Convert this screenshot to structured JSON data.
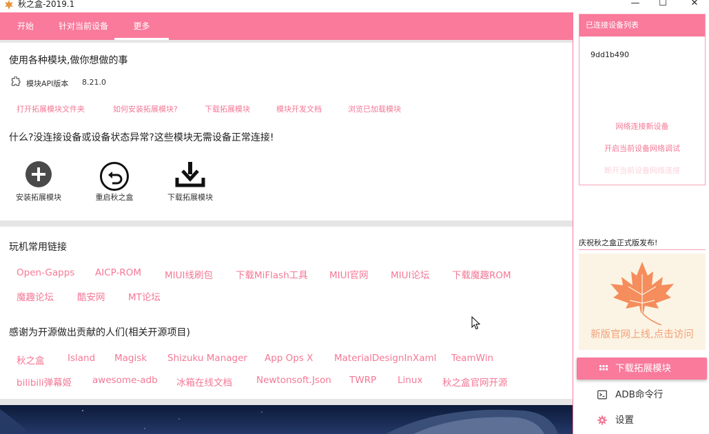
{
  "window": {
    "title": "秋之盒-2019.1",
    "minimize": "—",
    "maximize": "☐",
    "close": "✕"
  },
  "tabs": [
    {
      "label": "开始"
    },
    {
      "label": "针对当前设备"
    },
    {
      "label": "更多"
    }
  ],
  "active_tab": "更多",
  "modules": {
    "heading": "使用各种模块,做你想做的事",
    "api_label": "模块API版本",
    "api_version": "8.21.0",
    "links": [
      "打开拓展模块文件夹",
      "如何安装拓展模块?",
      "下载拓展模块",
      "模块开发文档",
      "浏览已加载模块"
    ],
    "offline_heading": "什么?没连接设备或设备状态异常?这些模块无需设备正常连接!",
    "actions": [
      {
        "icon": "plus-circle-icon",
        "label": "安装拓展模块"
      },
      {
        "icon": "restart-icon",
        "label": "重启秋之盒"
      },
      {
        "icon": "download-icon",
        "label": "下载拓展模块"
      }
    ]
  },
  "common_links": {
    "heading": "玩机常用链接",
    "row1": [
      "Open-Gapps",
      "AICP-ROM",
      "MIUI线刷包",
      "下载MiFlash工具",
      "MIUI官网",
      "MIUI论坛",
      "下载魔趣ROM"
    ],
    "row2": [
      "魔趣论坛",
      "酷安网",
      "MT论坛"
    ]
  },
  "credits": {
    "heading": "感谢为开源做出贡献的人们(相关开源项目)",
    "row1": [
      "秋之盒",
      "Island",
      "Magisk",
      "Shizuku Manager",
      "App Ops X",
      "MaterialDesignInXaml",
      "TeamWin"
    ],
    "row2": [
      "bilibili弹幕姬",
      "awesome-adb",
      "冰箱在线文档",
      "Newtonsoft.Json",
      "TWRP",
      "Linux",
      "秋之盒官网开源"
    ]
  },
  "devices": {
    "header": "已连接设备列表",
    "items": [
      "9dd1b490"
    ],
    "links": [
      "网络连接新设备",
      "开启当前设备网络调试",
      "断开当前设备网络连接"
    ]
  },
  "promo": {
    "title": "庆祝秋之盒正式版发布!",
    "caption": "新版官网上线,点击访问"
  },
  "nav": [
    {
      "icon": "grid-icon",
      "label": "下载拓展模块",
      "active": true
    },
    {
      "icon": "terminal-icon",
      "label": "ADB命令行",
      "active": false
    },
    {
      "icon": "gear-icon",
      "label": "设置",
      "active": false
    }
  ],
  "colors": {
    "accent": "#f97a9b",
    "link": "#f47895",
    "promo_text": "#f4a07a",
    "maple_leaf": "#f58d5c"
  }
}
